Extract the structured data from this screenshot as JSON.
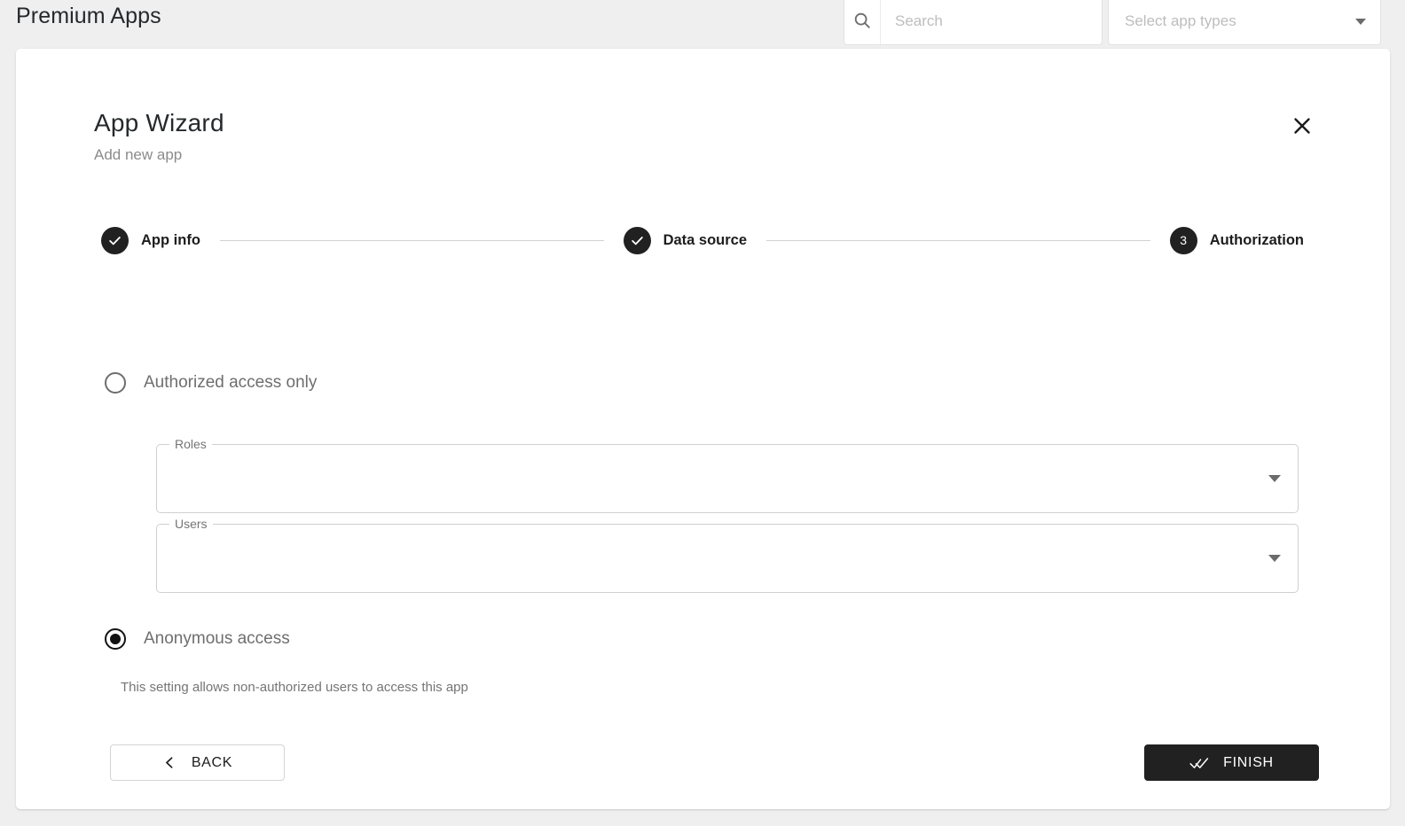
{
  "header": {
    "title": "Premium Apps",
    "search": {
      "icon": "search-icon",
      "placeholder": "Search",
      "value": ""
    },
    "app_types_select": {
      "placeholder": "Select app types",
      "value": "",
      "icon": "chevron-down-icon"
    }
  },
  "wizard": {
    "title": "App Wizard",
    "subtitle": "Add new app",
    "close_icon": "close-icon",
    "steps": [
      {
        "marker": "✓",
        "label": "App info",
        "state": "completed"
      },
      {
        "marker": "✓",
        "label": "Data source",
        "state": "completed"
      },
      {
        "marker": "3",
        "label": "Authorization",
        "state": "active"
      }
    ],
    "options": [
      {
        "label": "Authorized access only",
        "selected": false
      },
      {
        "label": "Anonymous access",
        "selected": true
      }
    ],
    "fields": [
      {
        "legend": "Roles",
        "value": "",
        "icon": "chevron-down-icon"
      },
      {
        "legend": "Users",
        "value": "",
        "icon": "chevron-down-icon"
      }
    ],
    "helper_text": "This setting allows non-authorized users to access this app",
    "buttons": {
      "back": {
        "label": "BACK",
        "icon": "chevron-left-icon"
      },
      "finish": {
        "label": "FINISH",
        "icon": "done-all-icon"
      }
    }
  },
  "colors": {
    "page_background": "#efefef",
    "card_background": "#ffffff",
    "accent_dark": "#212121",
    "muted_text": "#757575"
  }
}
